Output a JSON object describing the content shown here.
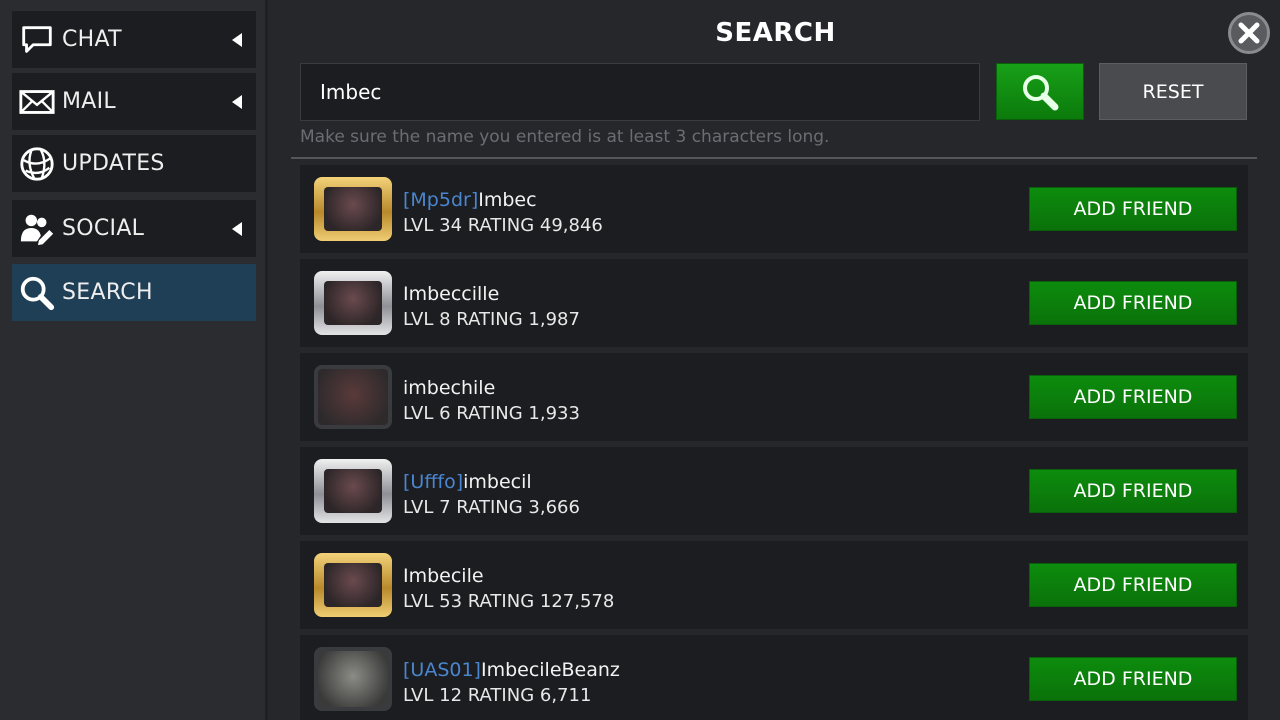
{
  "sidebar": {
    "items": [
      {
        "label": "CHAT",
        "icon": "chat-icon",
        "has_arrow": true,
        "active": false
      },
      {
        "label": "MAIL",
        "icon": "mail-icon",
        "has_arrow": true,
        "active": false
      },
      {
        "label": "UPDATES",
        "icon": "globe-icon",
        "has_arrow": false,
        "active": false
      },
      {
        "label": "SOCIAL",
        "icon": "social-icon",
        "has_arrow": true,
        "active": false
      },
      {
        "label": "SEARCH",
        "icon": "search-icon",
        "has_arrow": false,
        "active": true
      }
    ]
  },
  "main": {
    "title": "SEARCH",
    "search": {
      "value": "Imbec"
    },
    "reset_label": "RESET",
    "hint": "Make sure the name you entered is at least 3 characters long."
  },
  "results": [
    {
      "tag": "[Mp5dr]",
      "name": "Imbec",
      "stats": "LVL 34  RATING 49,846",
      "frame": "gold",
      "button": "ADD FRIEND"
    },
    {
      "tag": "",
      "name": "Imbeccille",
      "stats": "LVL 8  RATING 1,987",
      "frame": "silver",
      "button": "ADD FRIEND"
    },
    {
      "tag": "",
      "name": "imbechile",
      "stats": "LVL 6  RATING 1,933",
      "frame": "plain",
      "button": "ADD FRIEND"
    },
    {
      "tag": "[Ufffo]",
      "name": "imbecil",
      "stats": "LVL 7  RATING 3,666",
      "frame": "silver",
      "button": "ADD FRIEND"
    },
    {
      "tag": "",
      "name": "Imbecile",
      "stats": "LVL 53  RATING 127,578",
      "frame": "gold",
      "button": "ADD FRIEND"
    },
    {
      "tag": "[UAS01]",
      "name": "ImbecileBeanz",
      "stats": "LVL 12  RATING 6,711",
      "frame": "plain gray",
      "button": "ADD FRIEND"
    }
  ],
  "colors": {
    "accent_green": "#0d8c0d",
    "active_nav": "#1f3f56",
    "tag_blue": "#4a86cf"
  }
}
